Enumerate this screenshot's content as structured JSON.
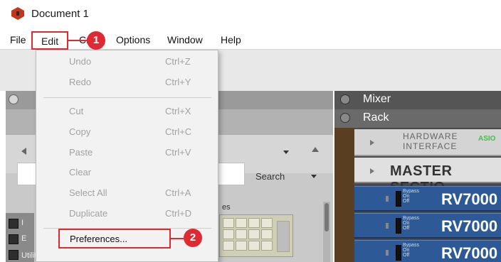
{
  "window": {
    "title": "Document 1"
  },
  "menubar": {
    "file": "File",
    "edit": "Edit",
    "create": "Cr",
    "options": "Options",
    "window": "Window",
    "help": "Help"
  },
  "edit_menu": {
    "items": [
      {
        "label": "Undo",
        "shortcut": "Ctrl+Z"
      },
      {
        "label": "Redo",
        "shortcut": "Ctrl+Y"
      },
      {
        "label": "Cut",
        "shortcut": "Ctrl+X"
      },
      {
        "label": "Copy",
        "shortcut": "Ctrl+C"
      },
      {
        "label": "Paste",
        "shortcut": "Ctrl+V"
      },
      {
        "label": "Clear",
        "shortcut": ""
      },
      {
        "label": "Select All",
        "shortcut": "Ctrl+A"
      },
      {
        "label": "Duplicate",
        "shortcut": "Ctrl+D"
      }
    ],
    "preferences": "Preferences..."
  },
  "callouts": {
    "first": "1",
    "second": "2"
  },
  "browser": {
    "search_label": "Search",
    "tree_partial_1": "I",
    "tree_partial_2": "E",
    "tree_partial_3": "Utilities",
    "grid_header_partial": "es"
  },
  "rack": {
    "mixer": "Mixer",
    "rack": "Rack",
    "hardware_interface_line1": "HARDWARE",
    "hardware_interface_line2": "INTERFACE",
    "asio": "ASIO",
    "master_section": "MASTER SECTIO",
    "bypass_line1": "Bypass",
    "bypass_line2": "On",
    "bypass_line3": "Off",
    "rv_units": [
      "RV7000",
      "RV7000",
      "RV7000"
    ]
  },
  "colors": {
    "accent": "#e02a33",
    "rack_blue": "#2d5a96",
    "menu_disabled_text": "#a2a2a2"
  }
}
